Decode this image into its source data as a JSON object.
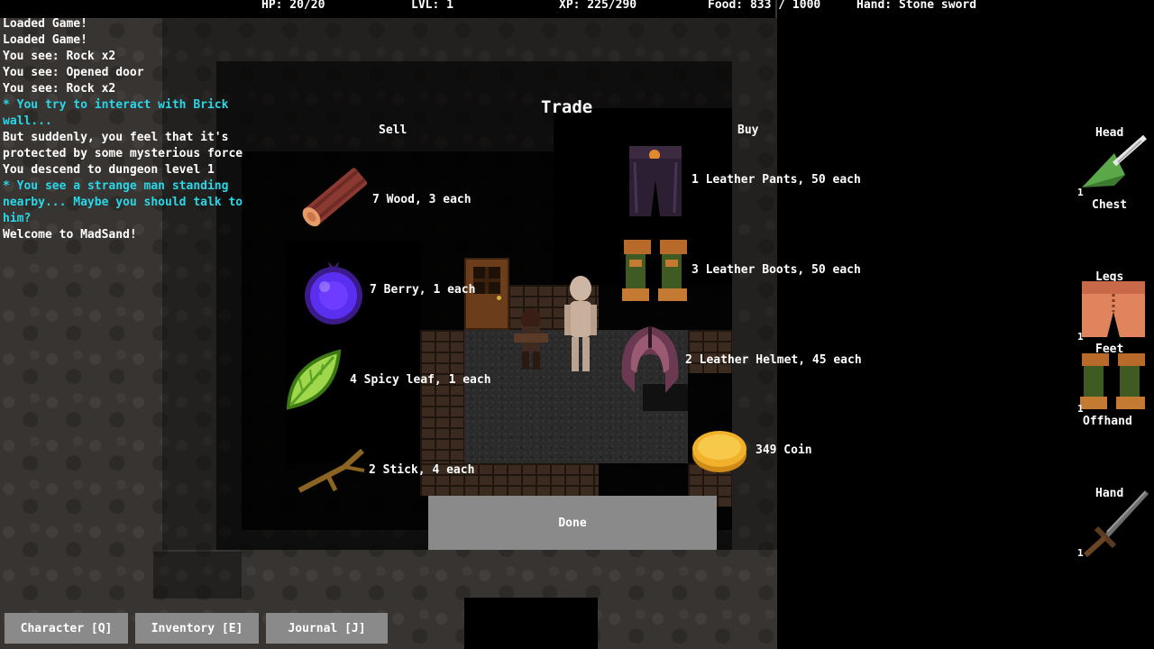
{
  "hud": {
    "hp": "HP: 20/20",
    "lvl": "LVL: 1",
    "xp": "XP: 225/290",
    "food": "Food: 833 / 1000",
    "hand": "Hand: Stone sword"
  },
  "log": [
    {
      "text": "Loaded Game!",
      "cyan": false
    },
    {
      "text": "Loaded Game!",
      "cyan": false
    },
    {
      "text": "You see: Rock x2",
      "cyan": false
    },
    {
      "text": "You see: Opened door",
      "cyan": false
    },
    {
      "text": "You see: Rock x2",
      "cyan": false
    },
    {
      "text": "* You try to interact with Brick wall...",
      "cyan": true
    },
    {
      "text": "But suddenly, you feel that it's protected by some mysterious force",
      "cyan": false
    },
    {
      "text": "You descend to dungeon level 1",
      "cyan": false
    },
    {
      "text": "* You see a strange man standing nearby... Maybe you should talk to him?",
      "cyan": true
    },
    {
      "text": "Welcome to MadSand!",
      "cyan": false
    }
  ],
  "trade": {
    "title": "Trade",
    "sell_label": "Sell",
    "buy_label": "Buy",
    "sell_items": [
      {
        "icon": "wood-log-icon",
        "label": "7 Wood, 3 each"
      },
      {
        "icon": "berry-icon",
        "label": "7 Berry, 1 each"
      },
      {
        "icon": "spicy-leaf-icon",
        "label": "4 Spicy leaf, 1 each"
      },
      {
        "icon": "stick-icon",
        "label": "2 Stick, 4 each"
      }
    ],
    "buy_items": [
      {
        "icon": "leather-pants-icon",
        "label": "1 Leather Pants, 50 each"
      },
      {
        "icon": "leather-boots-icon",
        "label": "3 Leather Boots, 50 each"
      },
      {
        "icon": "leather-helmet-icon",
        "label": "2 Leather Helmet, 45 each"
      }
    ],
    "coin": {
      "icon": "coin-icon",
      "label": "349 Coin"
    },
    "done_label": "Done"
  },
  "equipment": {
    "head": "Head",
    "chest": "Chest",
    "legs": "Legs",
    "feet": "Feet",
    "offhand": "Offhand",
    "hand": "Hand",
    "counts": {
      "head_item": "1",
      "legs_item": "1",
      "feet_item": "1",
      "hand_item": "1"
    }
  },
  "buttons": {
    "character": "Character [Q]",
    "inventory": "Inventory [E]",
    "journal": "Journal [J]"
  },
  "colors": {
    "log_highlight": "#29d7e8",
    "button_bg": "#8a8a8a",
    "coin": "#f2b12b"
  }
}
